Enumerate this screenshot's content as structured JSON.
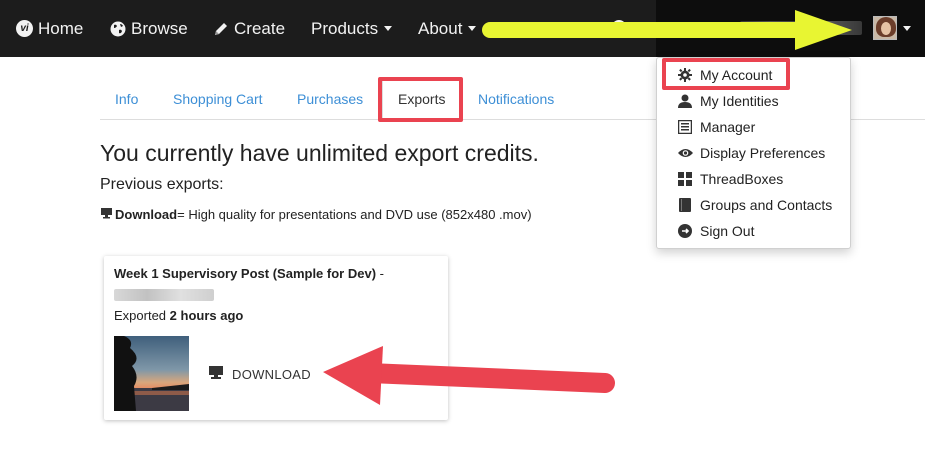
{
  "navbar": {
    "home": "Home",
    "browse": "Browse",
    "create": "Create",
    "products": "Products",
    "about": "About"
  },
  "tabs": [
    "Info",
    "Shopping Cart",
    "Purchases",
    "Exports",
    "Notifications"
  ],
  "content": {
    "headline": "You currently have unlimited export credits.",
    "subhead": "Previous exports:",
    "note_bold": "Download",
    "note_text": " = High quality for presentations and DVD use (852x480 .mov)"
  },
  "card": {
    "title": "Week 1 Supervisory Post (Sample for Dev)",
    "title_dash": " -",
    "exported_prefix": "Exported ",
    "exported_time": "2 hours ago",
    "download": "DOWNLOAD"
  },
  "dropdown": {
    "items": [
      "My Account",
      "My Identities",
      "Manager",
      "Display Preferences",
      "ThreadBoxes",
      "Groups and Contacts",
      "Sign Out"
    ]
  },
  "colors": {
    "navbar": "#1c1c1c",
    "link": "#3d8fd6",
    "highlight": "#ea4350",
    "yellow_arrow": "#e8f532",
    "red_arrow": "#ea4350"
  }
}
